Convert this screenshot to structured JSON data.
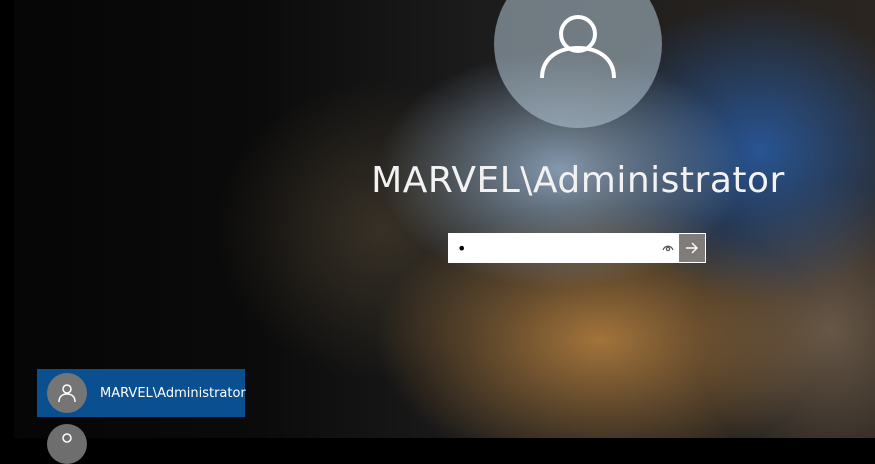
{
  "user": {
    "display_name": "MARVEL\\Administrator"
  },
  "password": {
    "value": "•",
    "placeholder": ""
  },
  "user_list": [
    {
      "label": "MARVEL\\Administrator",
      "selected": true
    },
    {
      "label": "",
      "selected": false
    }
  ],
  "icons": {
    "avatar": "user-icon",
    "reveal": "eye-icon",
    "submit": "arrow-right-icon"
  },
  "colors": {
    "selected_tile": "#0a4f8f",
    "submit_button": "#7f7c79"
  }
}
